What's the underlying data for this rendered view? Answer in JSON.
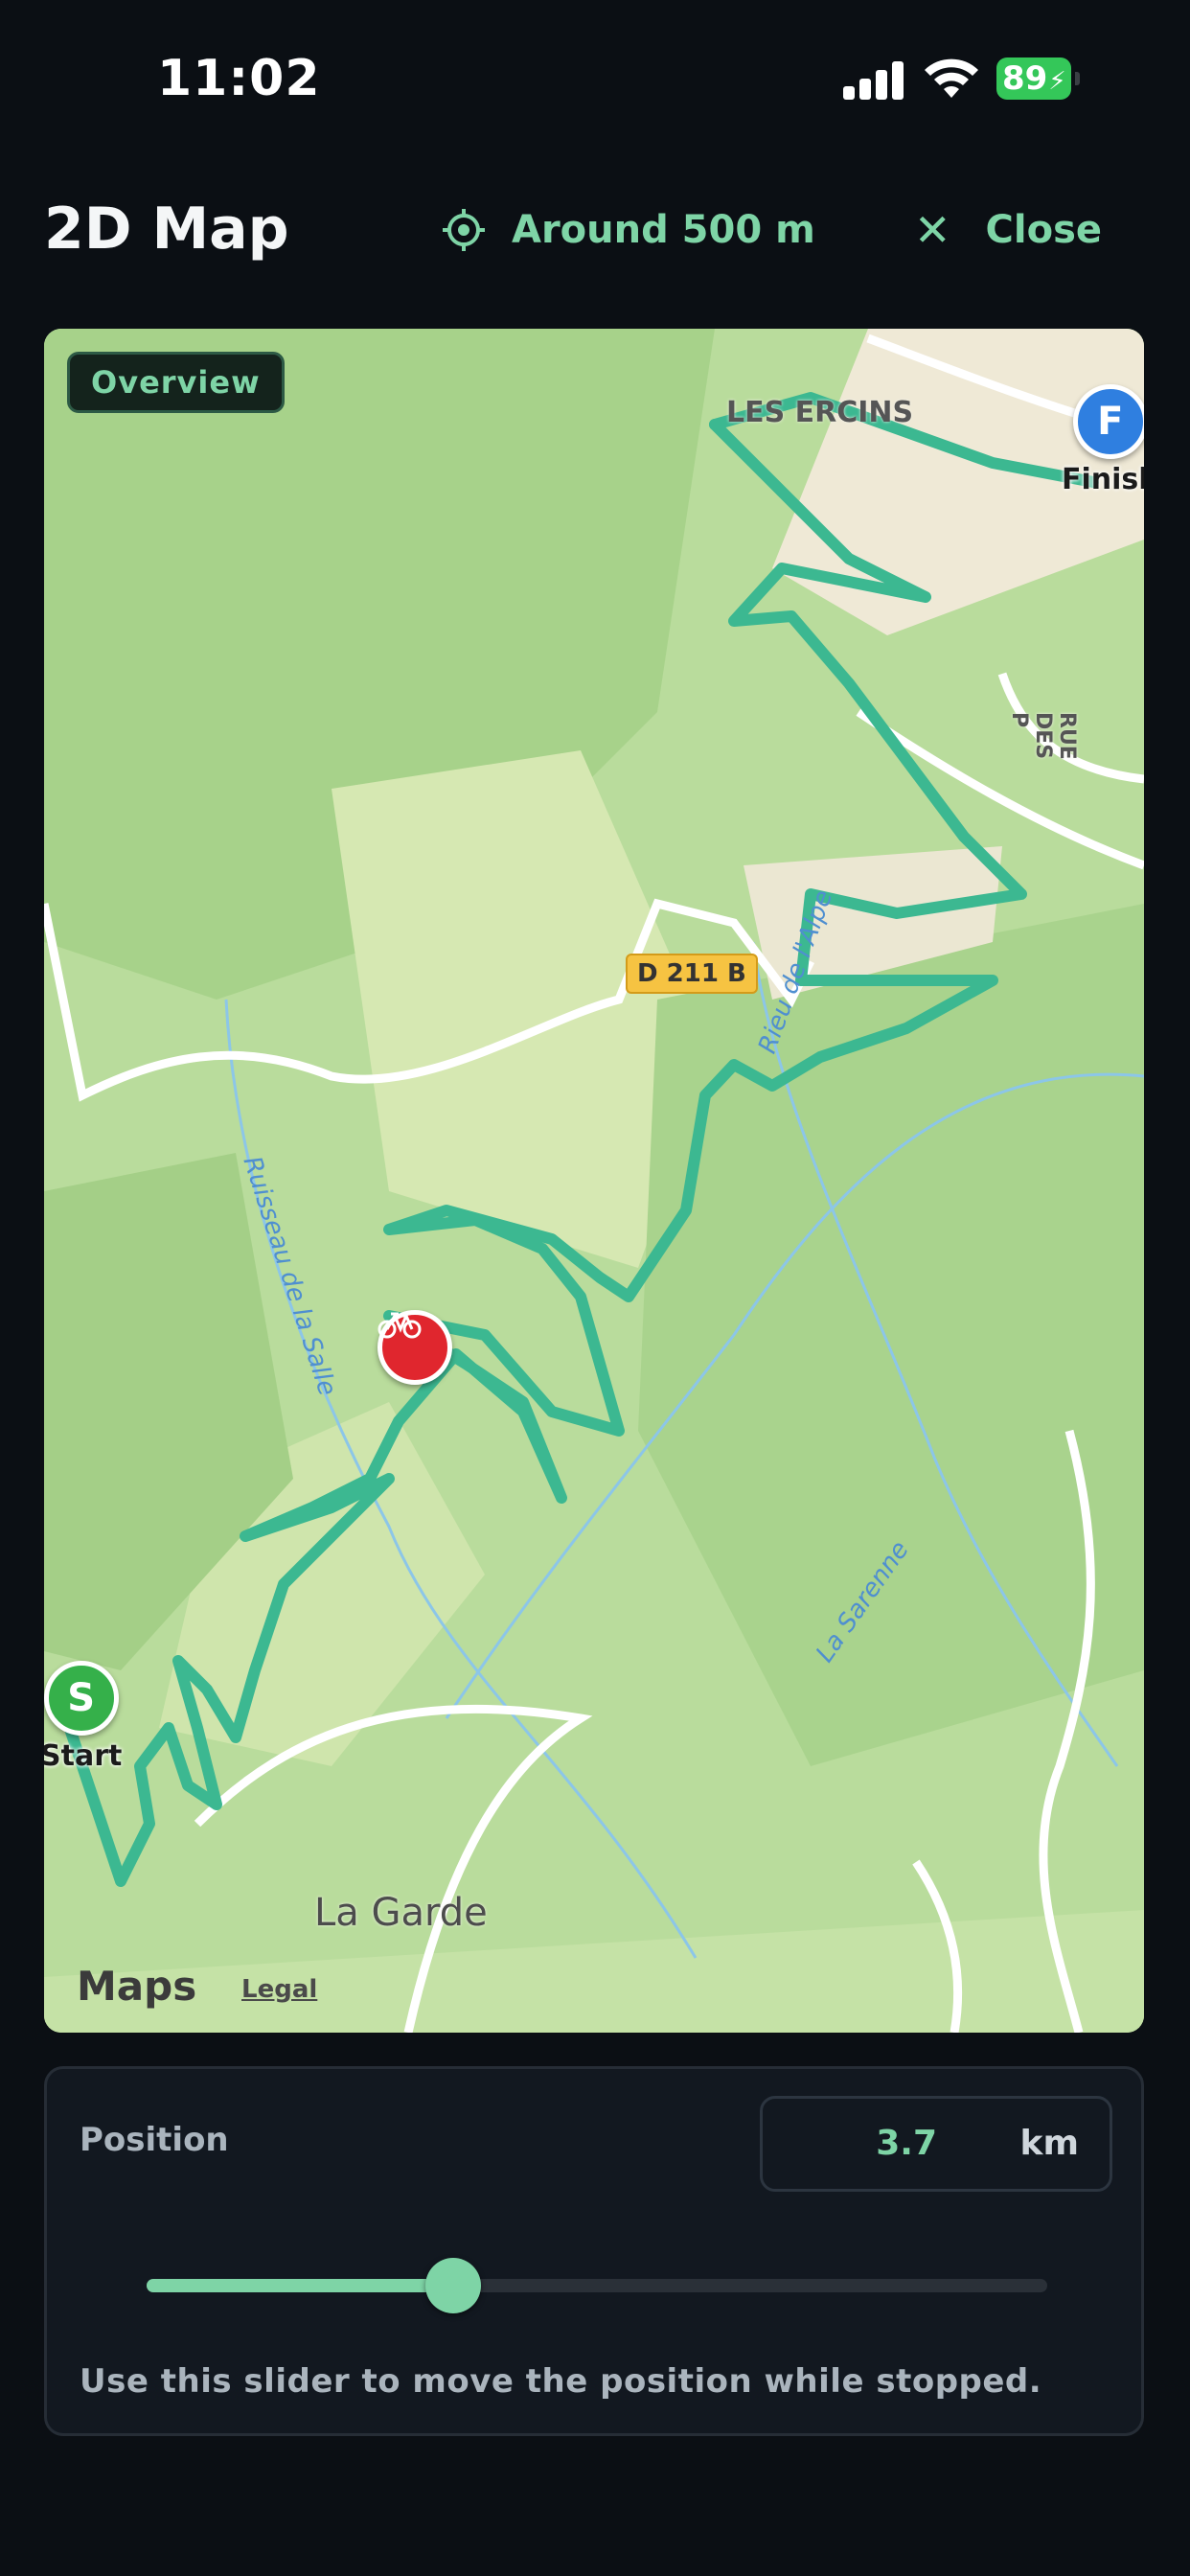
{
  "status_bar": {
    "time": "11:02",
    "battery": "89"
  },
  "header": {
    "title": "2D Map",
    "radius_label": "Around 500 m",
    "close_label": "Close"
  },
  "map": {
    "overview_label": "Overview",
    "place_labels": {
      "les_ercins": "LES ERCINS",
      "la_garde": "La Garde",
      "rue": "RUE DES P"
    },
    "water_labels": {
      "rieu": "Rieu de l'Alpe",
      "ruisseau": "Ruisseau de la Salle",
      "sarenne": "La Sarenne"
    },
    "road_shield": "D 211 B",
    "markers": {
      "start_letter": "S",
      "start_label": "Start",
      "finish_letter": "F",
      "finish_label": "Finish"
    },
    "attribution": {
      "logo": "Maps",
      "legal": "Legal"
    },
    "colors": {
      "route": "#3cb891",
      "start": "#35b04a",
      "finish": "#2f7fe0",
      "rider": "#e0262e"
    }
  },
  "position_panel": {
    "label": "Position",
    "value": "3.7",
    "unit": "km",
    "slider_fraction": 0.34,
    "hint": "Use this slider to move the position while stopped."
  }
}
